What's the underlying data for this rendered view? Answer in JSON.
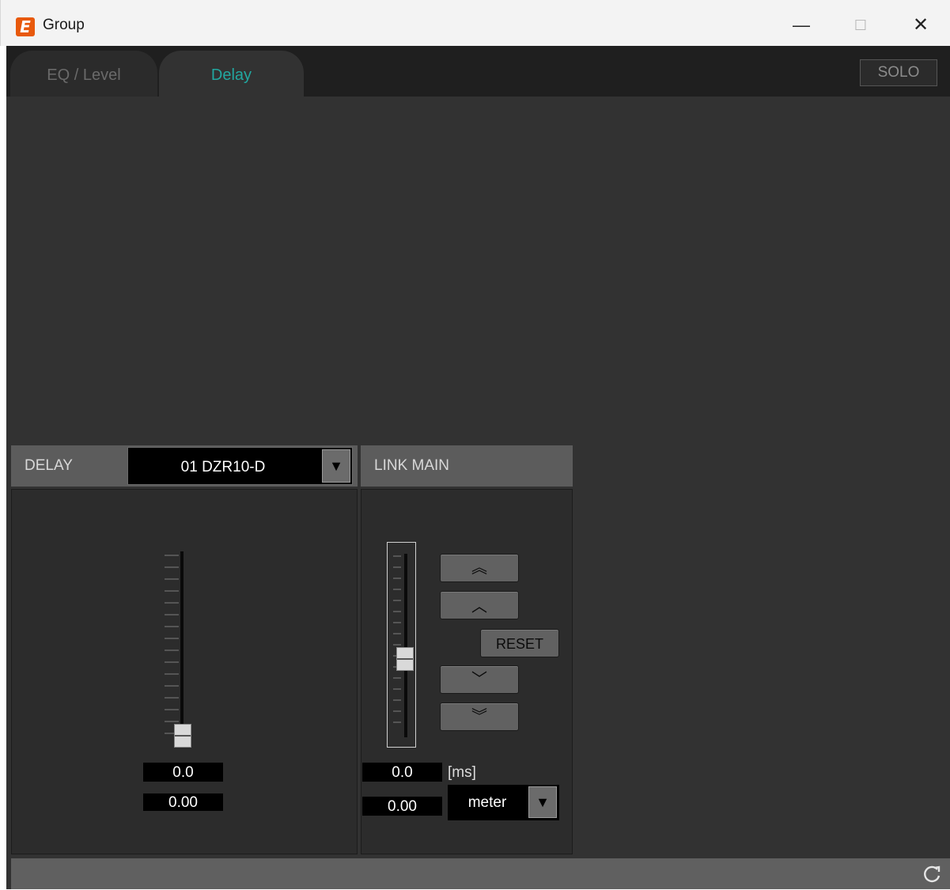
{
  "window": {
    "title": "Group",
    "minimize": "—",
    "maximize": "☐",
    "close": "✕",
    "icon": "app-logo-icon"
  },
  "tabs": [
    {
      "label": "EQ / Level",
      "active": false
    },
    {
      "label": "Delay",
      "active": true
    }
  ],
  "solo": {
    "label": "SOLO"
  },
  "delay_panel": {
    "header": "DELAY",
    "channel_select": {
      "value": "01 DZR10-D",
      "arrow": "▼"
    },
    "fader": {
      "level": 0.0
    },
    "value_ms": "0.0",
    "value_meter": "0.00"
  },
  "link_panel": {
    "header": "LINK MAIN",
    "fader": {
      "level": 0.42
    },
    "buttons": {
      "up_fast": "︽",
      "up": "︿",
      "reset": "RESET",
      "down": "﹀",
      "down_fast": "︾"
    },
    "value_ms": "0.0",
    "unit_ms": "[ms]",
    "value_meter": "0.00",
    "unit_select": {
      "value": "meter",
      "arrow": "▼"
    }
  },
  "colors": {
    "accent_tab": "#22a7a0",
    "app_icon": "#e8590c",
    "background": "#323232"
  }
}
